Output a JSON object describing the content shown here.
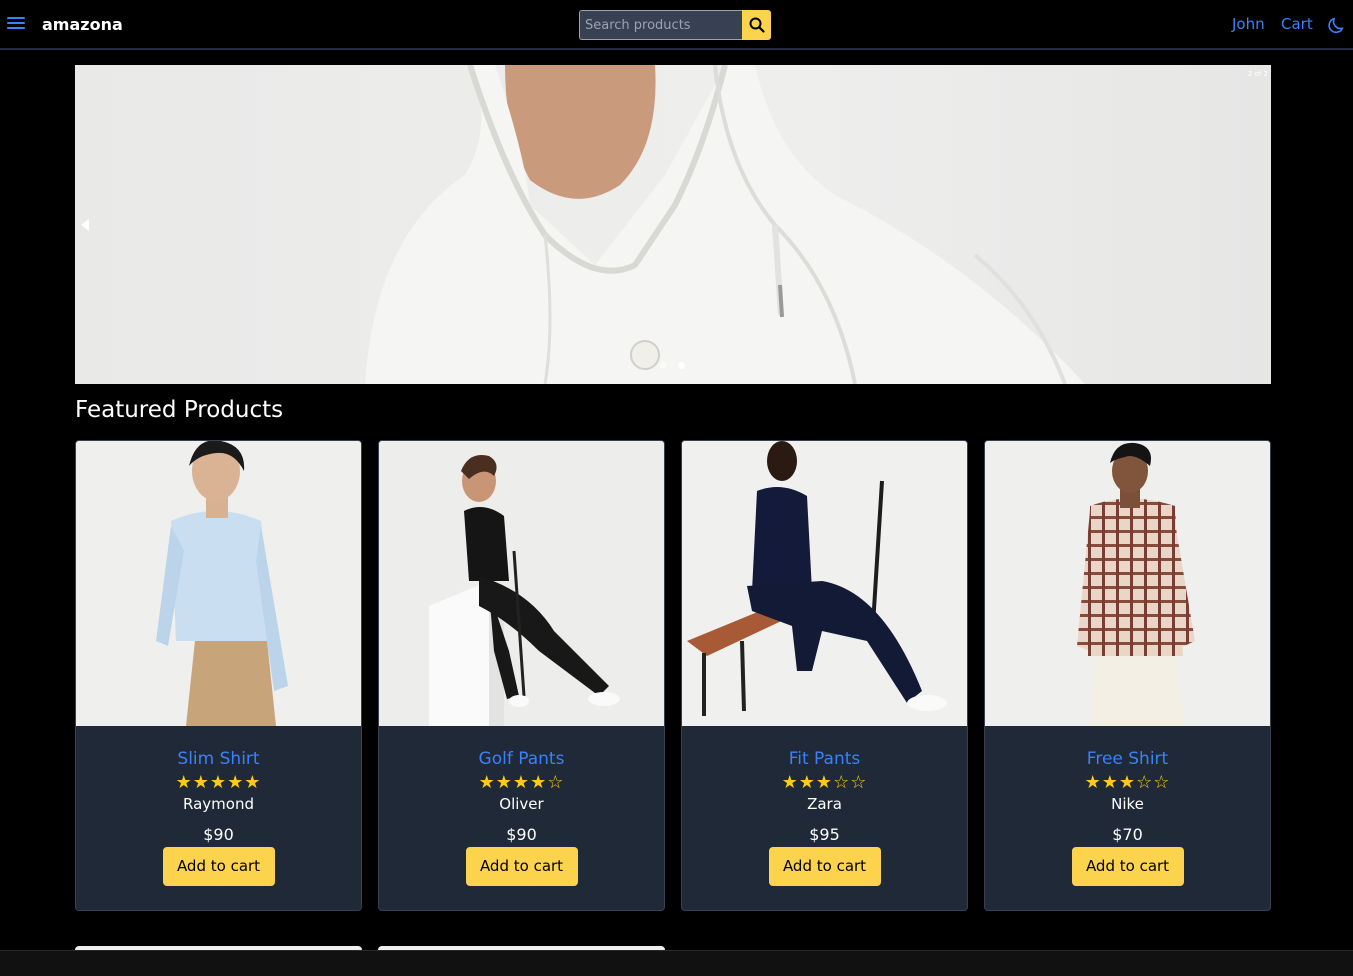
{
  "header": {
    "brand": "amazona",
    "search_placeholder": "Search products",
    "user": "John",
    "cart": "Cart"
  },
  "carousel": {
    "counter": "2 of 2",
    "slide_count": 2,
    "active_index": 1
  },
  "featured": {
    "title": "Featured Products",
    "products": [
      {
        "name": "Slim Shirt",
        "rating": 5,
        "stars": "★★★★★",
        "brand": "Raymond",
        "price": "$90",
        "button": "Add to cart"
      },
      {
        "name": "Golf Pants",
        "rating": 4,
        "stars": "★★★★☆",
        "brand": "Oliver",
        "price": "$90",
        "button": "Add to cart"
      },
      {
        "name": "Fit Pants",
        "rating": 3,
        "stars": "★★★☆☆",
        "brand": "Zara",
        "price": "$95",
        "button": "Add to cart"
      },
      {
        "name": "Free Shirt",
        "rating": 3,
        "stars": "★★★☆☆",
        "brand": "Nike",
        "price": "$70",
        "button": "Add to cart"
      }
    ]
  },
  "colors": {
    "accent": "#3b82f6",
    "button": "#fcd34d",
    "card": "#1f2937",
    "star": "#facc15"
  },
  "icons": {
    "menu": "menu-icon",
    "search": "search-icon",
    "theme": "moon-icon"
  }
}
